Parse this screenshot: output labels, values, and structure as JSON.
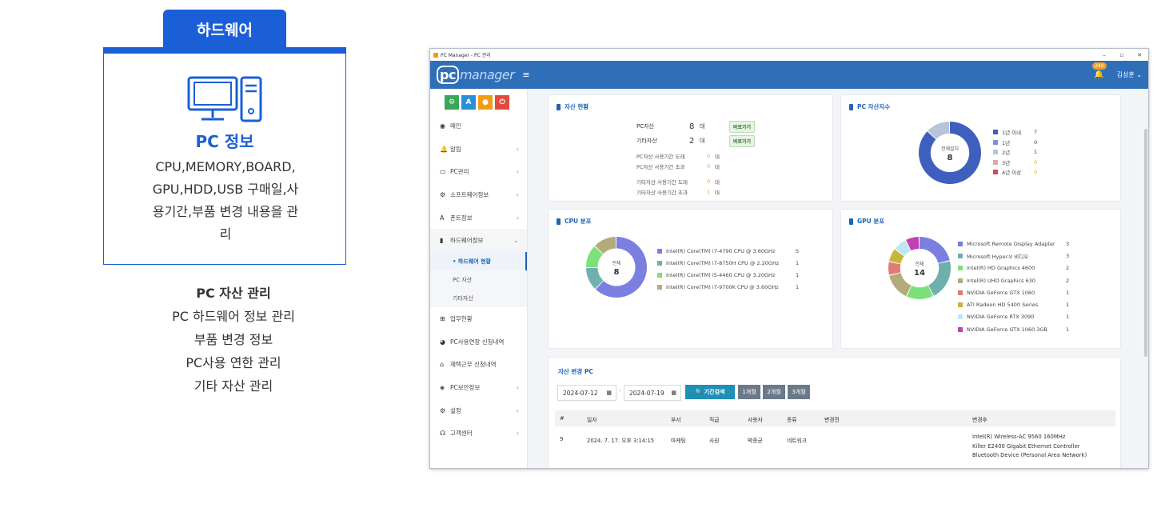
{
  "promo": {
    "tab_label": "하드웨어",
    "title": "PC 정보",
    "description": "CPU,MEMORY,BOARD,GPU,HDD,USB 구매일,사용기간,부품 변경 내용을 관리",
    "features": [
      "PC 자산 관리",
      "PC 하드웨어 정보 관리",
      "부품 변경 정보",
      "PC사용 연한 관리",
      "기타 자산 관리"
    ]
  },
  "window": {
    "title": "PC Manager - PC 관리",
    "controls": [
      "–",
      "▫",
      "✕"
    ]
  },
  "topbar": {
    "logo_pc": "pc",
    "logo_manager": "manager",
    "bell_count": "240",
    "user": "김성훈 ⌄"
  },
  "sidebar": {
    "quick_buttons": [
      {
        "icon": "⚙",
        "color": "#3aa757"
      },
      {
        "icon": "A",
        "color": "#2a8fd8"
      },
      {
        "icon": "●",
        "color": "#f39c12"
      },
      {
        "icon": "⏻",
        "color": "#e34a3a"
      }
    ],
    "items": [
      {
        "label": "메인",
        "icon": "◉"
      },
      {
        "label": "알림",
        "icon": "🔔"
      },
      {
        "label": "PC관리",
        "icon": "▭"
      },
      {
        "label": "소프트웨어정보",
        "icon": "⚙"
      },
      {
        "label": "폰트정보",
        "icon": "A"
      },
      {
        "label": "하드웨어정보",
        "icon": "▮"
      },
      {
        "label": "업무현황",
        "icon": "⊞"
      },
      {
        "label": "PC사용연장 신청내역",
        "icon": "◕"
      },
      {
        "label": "재택근무 신청내역",
        "icon": "⌂"
      },
      {
        "label": "PC보안정보",
        "icon": "◈"
      },
      {
        "label": "설정",
        "icon": "⚙"
      },
      {
        "label": "고객센터",
        "icon": "☊"
      }
    ],
    "sub_items": [
      "• 하드웨어 현황",
      "PC 자산",
      "기타자산"
    ]
  },
  "asset_card": {
    "title": "자산 현황",
    "rows": [
      {
        "label": "PC자산",
        "value": "8",
        "unit": "대",
        "button": "바로가기"
      },
      {
        "label": "기타자산",
        "value": "2",
        "unit": "대",
        "button": "바로가기"
      }
    ],
    "usage": [
      {
        "label": "PC자산 사용기간 도래",
        "value": "0",
        "unit": "대"
      },
      {
        "label": "PC자산 사용기간 초과",
        "value": "0",
        "unit": "대"
      },
      {
        "label": "기타자산 사용기간 도래",
        "value": "0",
        "unit": "대"
      },
      {
        "label": "기타자산 사용기간 초과",
        "value": "1",
        "unit": "대"
      }
    ]
  },
  "age_card": {
    "title": "PC 자산지수",
    "center_label": "전체설치",
    "center_value": "8",
    "legend": [
      {
        "name": "1년 이내",
        "value": 7,
        "color": "#3f5fbf",
        "warn": false
      },
      {
        "name": "1년",
        "value": 0,
        "color": "#7b8fd6",
        "warn": false
      },
      {
        "name": "2년",
        "value": 1,
        "color": "#b7c3d6",
        "warn": false
      },
      {
        "name": "3년",
        "value": 0,
        "color": "#e3a3b4",
        "warn": true
      },
      {
        "name": "4년 이상",
        "value": 0,
        "color": "#d9455f",
        "warn": true
      }
    ]
  },
  "cpu_card": {
    "title": "CPU 분포",
    "center_label": "전체",
    "center_value": "8",
    "legend": [
      {
        "name": "Intel(R) Core(TM) i7-4790 CPU @ 3.60GHz",
        "value": 5,
        "color": "#7b7fe0"
      },
      {
        "name": "Intel(R) Core(TM) i7-8750H CPU @ 2.20GHz",
        "value": 1,
        "color": "#6fb0ad"
      },
      {
        "name": "Intel(R) Core(TM) i5-4460 CPU @ 3.20GHz",
        "value": 1,
        "color": "#7de07b"
      },
      {
        "name": "Intel(R) Core(TM) i7-9700K CPU @ 3.60GHz",
        "value": 1,
        "color": "#b4ab7a"
      }
    ]
  },
  "gpu_card": {
    "title": "GPU 분포",
    "center_label": "전체",
    "center_value": "14",
    "legend": [
      {
        "name": "Microsoft Remote Display Adapter",
        "value": 3,
        "color": "#7b7fe0"
      },
      {
        "name": "Microsoft Hyper-V 비디오",
        "value": 3,
        "color": "#6fb0ad"
      },
      {
        "name": "Intel(R) HD Graphics 4600",
        "value": 2,
        "color": "#7de07b"
      },
      {
        "name": "Intel(R) UHD Graphics 630",
        "value": 2,
        "color": "#b4ab7a"
      },
      {
        "name": "NVIDIA GeForce GTX 1060",
        "value": 1,
        "color": "#e27a7a"
      },
      {
        "name": "ATI Radeon HD 5400 Series",
        "value": 1,
        "color": "#c4b73c"
      },
      {
        "name": "NVIDIA GeForce RTX 3090",
        "value": 1,
        "color": "#bfe6f2"
      },
      {
        "name": "NVIDIA GeForce GTX 1060 3GB",
        "value": 1,
        "color": "#c23fb5"
      }
    ]
  },
  "history": {
    "title": "자산 변경 PC",
    "date_from": "2024-07-12",
    "date_sep": "-",
    "date_to": "2024-07-19",
    "search_label": "🔍 기간검색",
    "periods": [
      "1개월",
      "2개월",
      "3개월"
    ],
    "columns": [
      "#",
      "일자",
      "부서",
      "직급",
      "사용자",
      "종류",
      "변경전",
      "변경후"
    ],
    "rows": [
      {
        "no": "9",
        "date": "2024. 7. 17. 오후 3:14:15",
        "dept": "마케팅",
        "rank": "사원",
        "user": "박종균",
        "kind": "네트워크",
        "before": "",
        "after": [
          "Intel(R) Wireless-AC 9560 160MHz",
          "Killer E2400 Gigabit Ethernet Controller",
          "Bluetooth Device (Personal Area Network)"
        ]
      }
    ]
  }
}
